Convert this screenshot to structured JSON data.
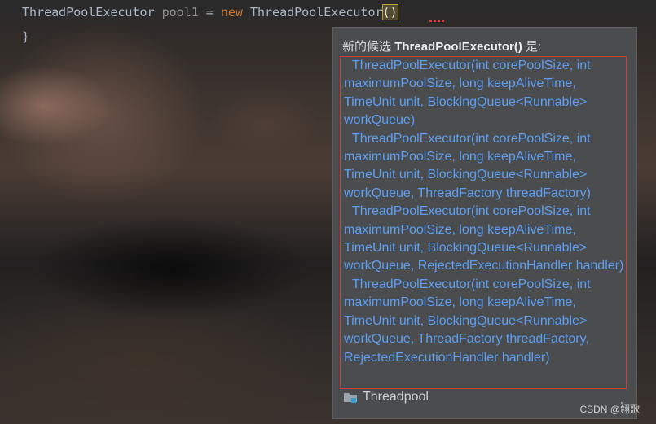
{
  "editor": {
    "line1": {
      "type_name": "ThreadPoolExecutor",
      "var_name": "pool1",
      "operator": "=",
      "keyword": "new",
      "ctor": "ThreadPoolExecutor",
      "paren": "()"
    },
    "line2": "}"
  },
  "popup": {
    "title_prefix": "新的候选",
    "title_name": "ThreadPoolExecutor()",
    "title_suffix": "是:",
    "candidates": [
      "ThreadPoolExecutor(int corePoolSize, int maximumPoolSize, long keepAliveTime, TimeUnit unit, BlockingQueue<Runnable> workQueue)",
      "ThreadPoolExecutor(int corePoolSize, int maximumPoolSize, long keepAliveTime, TimeUnit unit, BlockingQueue<Runnable> workQueue, ThreadFactory threadFactory)",
      "ThreadPoolExecutor(int corePoolSize, int maximumPoolSize, long keepAliveTime, TimeUnit unit, BlockingQueue<Runnable> workQueue, RejectedExecutionHandler handler)",
      "ThreadPoolExecutor(int corePoolSize, int maximumPoolSize, long keepAliveTime, TimeUnit unit, BlockingQueue<Runnable> workQueue, ThreadFactory threadFactory, RejectedExecutionHandler handler)"
    ],
    "footer_package": "Threadpool",
    "more_icon": "more-dots-icon"
  },
  "watermark": "CSDN @翎歌",
  "colors": {
    "candidate_text": "#5d9ef2",
    "highlight_border": "#d43a3a",
    "keyword": "#cc7832",
    "popup_bg": "#4a4c4e"
  }
}
